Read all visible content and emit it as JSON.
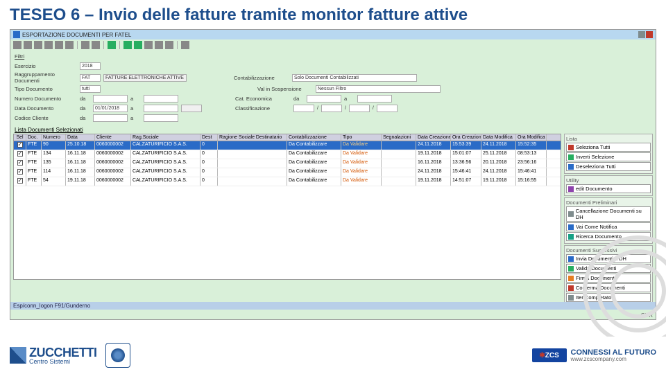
{
  "slide": {
    "title": "TESEO 6 – Invio delle fatture tramite monitor fatture attive"
  },
  "window": {
    "title": "ESPORTAZIONE DOCUMENTI PER FATEL",
    "statusbar": "Esp/conn_logon F91/Gunderno",
    "ovr": "OVR"
  },
  "form": {
    "filtri": "Filtri",
    "esercizio_lbl": "Esercizio",
    "esercizio": "2018",
    "ragg_lbl": "Raggruppamento Documenti",
    "ragg": "FAT",
    "ragg_desc": "FATTURE ELETTRONICHE ATTIVE",
    "tipo_lbl": "Tipo Documento",
    "tipo": "tutti",
    "numdoc_lbl": "Numero Documento",
    "da": "da",
    "a": "a",
    "datadoc_lbl": "Data Documento",
    "datadoc_da": "01/01/2018",
    "codcli_lbl": "Codice Cliente",
    "cont_lbl": "Contabilizzazione",
    "cont_val": "Solo Documenti Contabilizzati",
    "sosp_lbl": "Val in Sospensione",
    "sosp_val": "Nessun Filtro",
    "cateco_lbl": "Cat. Economica",
    "class_lbl": "Classificazione",
    "listlabel": "Lista Documenti Selezionati"
  },
  "grid": {
    "headers": [
      "Sel",
      "Doc.",
      "Numero",
      "Data",
      "Cliente",
      "Rag.Sociale",
      "Dest",
      "Ragione Sociale Destinatario",
      "Contabilizzazione",
      "Tipo",
      "Segnalazioni",
      "Data Creazione",
      "Ora Creazione",
      "Data Modifica",
      "Ora Modifica"
    ],
    "rows": [
      {
        "sel": true,
        "doc": "FTE",
        "num": "90",
        "data": "25.10.18",
        "cli": "0060000002",
        "rag": "CALZATURIFICIO S.A.S.",
        "dest": "0",
        "rsd": "",
        "cont": "Da Contabilizzare",
        "tipo": "Da Validare",
        "seg": "",
        "dc": "24.11.2018",
        "oc": "15:53:39",
        "dm": "24.11.2018",
        "om": "15:52:35"
      },
      {
        "sel": true,
        "doc": "FTE",
        "num": "134",
        "data": "16.11.18",
        "cli": "0060000002",
        "rag": "CALZATURIFICIO S.A.S.",
        "dest": "0",
        "rsd": "",
        "cont": "Da Contabilizzare",
        "tipo": "Da Validare",
        "seg": "",
        "dc": "19.11.2018",
        "oc": "15:01:07",
        "dm": "25.11.2018",
        "om": "08:53:13"
      },
      {
        "sel": true,
        "doc": "FTE",
        "num": "135",
        "data": "16.11.18",
        "cli": "0060000002",
        "rag": "CALZATURIFICIO S.A.S.",
        "dest": "0",
        "rsd": "",
        "cont": "Da Contabilizzare",
        "tipo": "Da Validare",
        "seg": "",
        "dc": "16.11.2018",
        "oc": "13:36:56",
        "dm": "20.11.2018",
        "om": "23:56:16"
      },
      {
        "sel": true,
        "doc": "FTE",
        "num": "114",
        "data": "16.11.18",
        "cli": "0060000002",
        "rag": "CALZATURIFICIO S.A.S.",
        "dest": "0",
        "rsd": "",
        "cont": "Da Contabilizzare",
        "tipo": "Da Validare",
        "seg": "",
        "dc": "24.11.2018",
        "oc": "15:46:41",
        "dm": "24.11.2018",
        "om": "15:46:41"
      },
      {
        "sel": true,
        "doc": "FTE",
        "num": "54",
        "data": "19.11.18",
        "cli": "0060000002",
        "rag": "CALZATURIFICIO S.A.S.",
        "dest": "0",
        "rsd": "",
        "cont": "Da Contabilizzare",
        "tipo": "Da Validare",
        "seg": "",
        "dc": "19.11.2018",
        "oc": "14:51:07",
        "dm": "19.11.2018",
        "om": "15:16:55"
      }
    ]
  },
  "side": {
    "lista": "Lista",
    "seleziona_tutti": "Seleziona Tutti",
    "inverti": "Inverti Selezione",
    "deseleziona": "Deseleziona Tutti",
    "utility": "Utility",
    "edit_doc": "edit Documento",
    "preliminari": "Documenti Preliminari",
    "cancellazione": "Cancellazione Documenti su DH",
    "vai_notifica": "Vai Come Notifica",
    "ricerca": "Ricerca Documento",
    "successivi": "Documenti Successivi",
    "invia": "Invia Documenti a DH",
    "valida": "Valida Documenti",
    "firma": "Firma Documenti",
    "conferma": "Conferma Documenti",
    "iter": "Iter Completato"
  },
  "footer": {
    "zucchetti_big": "ZUCCHETTI",
    "zucchetti_small": "Centro Sistemi",
    "zcs": "ZCS",
    "connessi": "CONNESSI AL FUTURO",
    "url": "www.zcscompany.com"
  }
}
